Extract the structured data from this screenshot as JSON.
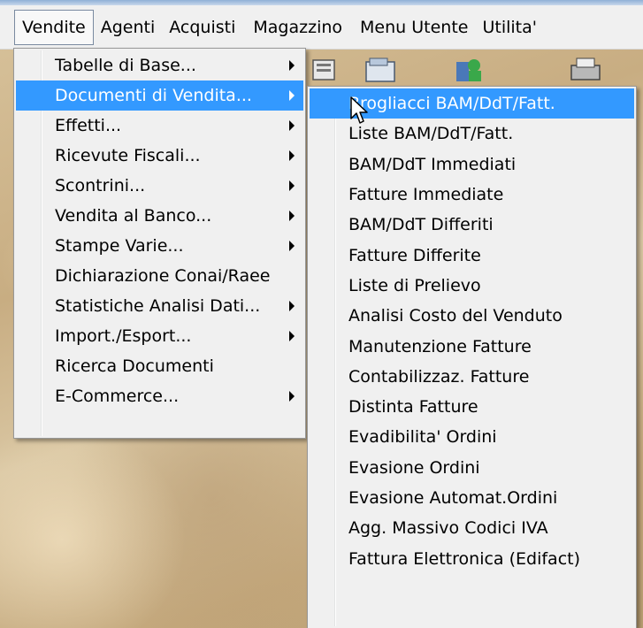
{
  "menubar": {
    "items": [
      {
        "label": "Vendite"
      },
      {
        "label": "Agenti"
      },
      {
        "label": "Acquisti"
      },
      {
        "label": "Magazzino"
      },
      {
        "label": "Menu Utente"
      },
      {
        "label": "Utilita'"
      }
    ]
  },
  "vendite_menu": {
    "items": [
      {
        "label": "Tabelle di Base..."
      },
      {
        "label": "Documenti di Vendita..."
      },
      {
        "label": "Effetti..."
      },
      {
        "label": "Ricevute Fiscali..."
      },
      {
        "label": "Scontrini..."
      },
      {
        "label": "Vendita al Banco..."
      },
      {
        "label": "Stampe Varie..."
      },
      {
        "label": "Dichiarazione Conai/Raee"
      },
      {
        "label": "Statistiche Analisi Dati..."
      },
      {
        "label": "Import./Esport..."
      },
      {
        "label": "Ricerca Documenti"
      },
      {
        "label": "E-Commerce..."
      }
    ]
  },
  "documenti_menu": {
    "items": [
      {
        "label": "Brogliacci BAM/DdT/Fatt."
      },
      {
        "label": "Liste BAM/DdT/Fatt."
      },
      {
        "label": "BAM/DdT Immediati"
      },
      {
        "label": "Fatture Immediate"
      },
      {
        "label": "BAM/DdT Differiti"
      },
      {
        "label": "Fatture Differite"
      },
      {
        "label": "Liste di Prelievo"
      },
      {
        "label": "Analisi Costo del Venduto"
      },
      {
        "label": "Manutenzione Fatture"
      },
      {
        "label": "Contabilizzaz. Fatture"
      },
      {
        "label": "Distinta Fatture"
      },
      {
        "label": "Evadibilita' Ordini"
      },
      {
        "label": "Evasione Ordini"
      },
      {
        "label": "Evasione Automat.Ordini"
      },
      {
        "label": "Agg. Massivo Codici IVA"
      },
      {
        "label": "Fattura Elettronica (Edifact)"
      }
    ]
  },
  "colors": {
    "highlight": "#3399ff",
    "menu_bg": "#f0f0f0"
  },
  "icons": {
    "toolbar": [
      "document-icon",
      "folder-icon",
      "users-icon",
      "printer-icon"
    ],
    "cursor": "mouse-pointer-icon"
  }
}
